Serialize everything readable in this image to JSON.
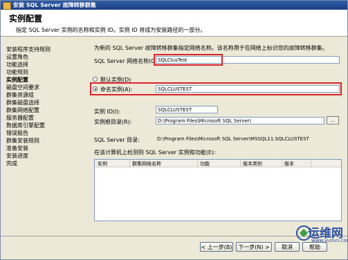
{
  "window": {
    "title": "安装 SQL Server 故障转移群集"
  },
  "header": {
    "title": "实例配置",
    "description": "指定 SQL Server 实例的名称和实例 ID。实例 ID 将成为安装路径的一部分。"
  },
  "nav": {
    "items": [
      {
        "label": "安装程序支持规则",
        "current": false
      },
      {
        "label": "设置角色",
        "current": false
      },
      {
        "label": "功能选择",
        "current": false
      },
      {
        "label": "功能规则",
        "current": false
      },
      {
        "label": "实例配置",
        "current": true
      },
      {
        "label": "磁盘空间要求",
        "current": false
      },
      {
        "label": "群集资源组",
        "current": false
      },
      {
        "label": "群集磁盘选择",
        "current": false
      },
      {
        "label": "群集网络配置",
        "current": false
      },
      {
        "label": "服务器配置",
        "current": false
      },
      {
        "label": "数据库引擎配置",
        "current": false
      },
      {
        "label": "错误报告",
        "current": false
      },
      {
        "label": "群集安装规则",
        "current": false
      },
      {
        "label": "准备安装",
        "current": false
      },
      {
        "label": "安装进度",
        "current": false
      },
      {
        "label": "完成",
        "current": false
      }
    ]
  },
  "form": {
    "intro": "为新的 SQL Server 故障转移群集指定网络名称。该名称用于在网络上标识您的故障转移群集。",
    "network_name_label": "SQL Server 网络名称(O):",
    "network_name_value": "SQLClusTest",
    "default_instance_label": "默认实例(D)",
    "named_instance_label": "命名实例(A):",
    "named_instance_value": "SQLCLUSTEST",
    "instance_id_label": "实例 ID(I):",
    "instance_id_value": "SQLCLUSTEST",
    "instance_root_label": "实例根目录(R):",
    "instance_root_value": "D:\\Program Files\\Microsoft SQL Server\\",
    "browse_label": "...",
    "sql_dir_label": "SQL Server 目录:",
    "sql_dir_value": "D:\\Program Files\\Microsoft SQL Server\\MSSQL11.SQLCLUSTEST",
    "detected_label": "在该计算机上检测到 SQL Server 实例和功能(E):",
    "table_headers": [
      "实例",
      "群集网络名称",
      "功能",
      "版本类别",
      "版本"
    ]
  },
  "buttons": {
    "back": "< 上一步(B)",
    "next": "下一步(N) >",
    "cancel": "取消",
    "help": "帮助"
  },
  "watermark": {
    "brand": "运维网",
    "url": "www.yunvn.com"
  },
  "colors": {
    "highlight_box": "#d8232a",
    "title_bar": "#2f5ea8"
  }
}
